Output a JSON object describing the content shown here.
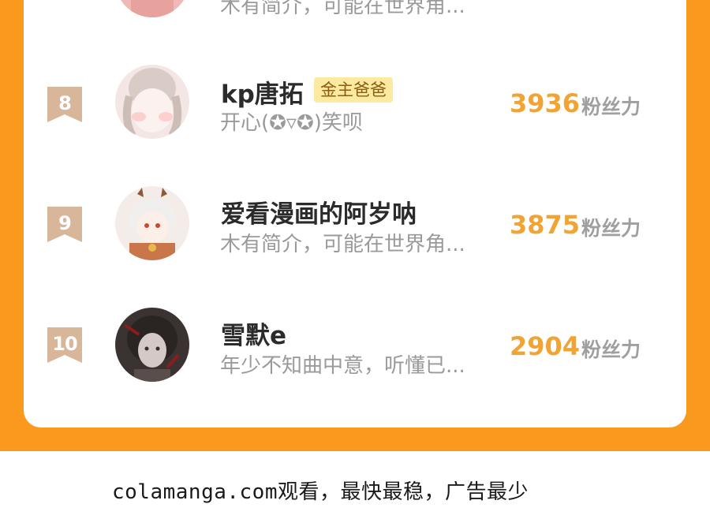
{
  "partial_row": {
    "bio": "木有简介，可能在世界角..."
  },
  "rows": [
    {
      "rank": "8",
      "name": "kp唐拓",
      "tag": "金主爸爸",
      "bio": "开心(✪▿✪)笑呗",
      "fans": "3936",
      "fans_label": "粉丝力",
      "avatar_colors": [
        "#f3e6e4",
        "#d9cbc6",
        "#fbdad8"
      ]
    },
    {
      "rank": "9",
      "name": "爱看漫画的阿岁呐",
      "bio": "木有简介，可能在世界角...",
      "fans": "3875",
      "fans_label": "粉丝力",
      "avatar_colors": [
        "#f4ece8",
        "#c9764a",
        "#e9d7cf"
      ]
    },
    {
      "rank": "10",
      "name": "雪默e",
      "bio": "年少不知曲中意，听懂已...",
      "fans": "2904",
      "fans_label": "粉丝力",
      "avatar_colors": [
        "#3a3331",
        "#d4c9c6",
        "#8a1e1e"
      ]
    }
  ],
  "footer": "colamanga.com观看，最快最稳，广告最少",
  "colors": {
    "page_bg": "#f99a1f",
    "fan_count": "#f1a433",
    "rank_badge": "#d8b69a"
  }
}
